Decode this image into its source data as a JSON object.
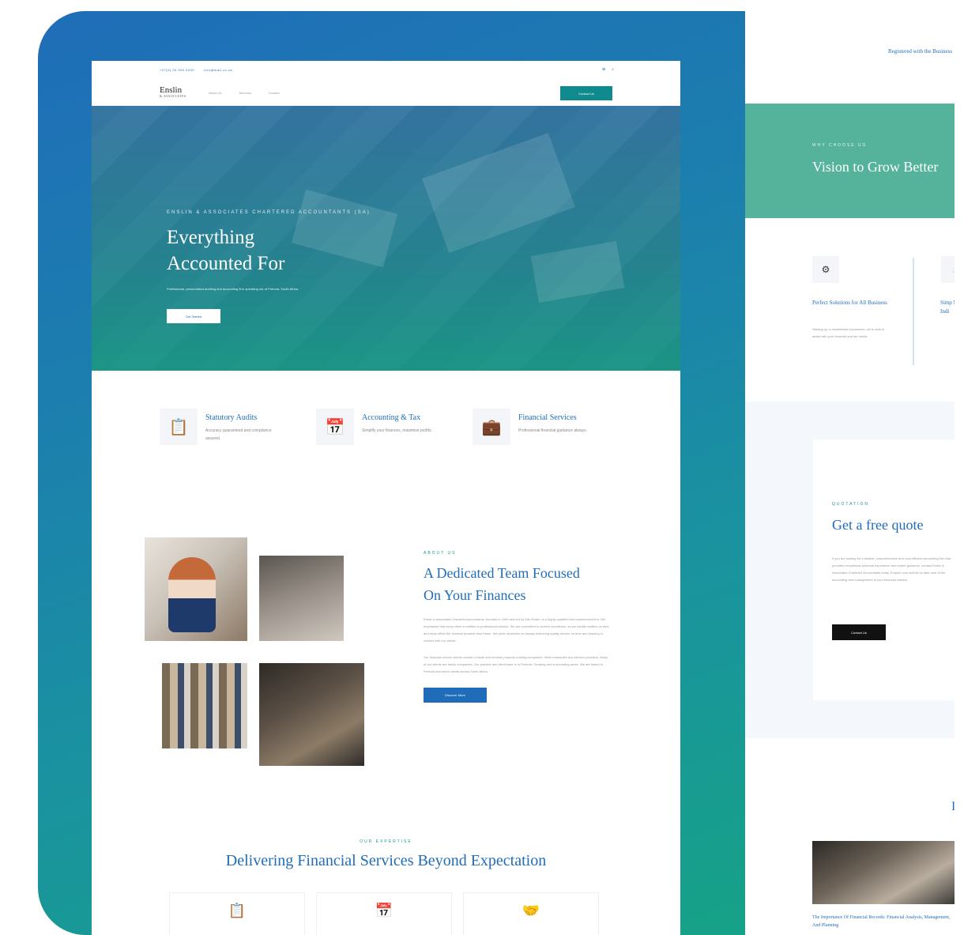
{
  "main_page": {
    "topbar": {
      "util_links": [
        "+27(0) 00 000 0000",
        "info@mail.co.za"
      ],
      "util_icons": [
        "globe-icon",
        "search-icon"
      ],
      "logo_name": "Enslin",
      "logo_sub": "& ASSOCIATES",
      "nav_items": [
        "About Us",
        "Services",
        "Contact"
      ],
      "contact_button": "Contact Us"
    },
    "hero": {
      "eyebrow": "ENSLIN & ASSOCIATES CHARTERED ACCOUNTANTS (SA)",
      "title_line1": "Everything",
      "title_line2": "Accounted For",
      "subtitle": "Professional, personalised auditing and accounting firm operating out of Pretoria, South Africa.",
      "cta": "Get Started"
    },
    "features": [
      {
        "icon": "clipboard-icon",
        "title": "Statutory Audits",
        "desc": "Accuracy guaranteed and compliance assured."
      },
      {
        "icon": "calendar-icon",
        "title": "Accounting & Tax",
        "desc": "Simplify your finances, maximise profits."
      },
      {
        "icon": "briefcase-icon",
        "title": "Financial Services",
        "desc": "Professional financial guidance always."
      }
    ],
    "about": {
      "eyebrow": "ABOUT US",
      "title_line1": "A Dedicated Team Focused",
      "title_line2": "On Your Finances",
      "para1": "Enslin & Associates Chartered Accountants, founded in 1999 and led by Dirk Enslin, is a highly qualified and experienced firm. We emphasise that every client is entitled to professional service. We are committed to service excellence, so we handle matters on time and reply within the shortest possible time frame. We pride ourselves on always delivering quality service on time and keeping in contact with our clients.",
      "para2": "Our financial service clients consist of small and medium property holding companies, retail companies and service providers. Many of our clients are family companies. Our practice and client base is in Pretoria, Gauteng and surrounding areas. We are based in Pretoria and serve clients across South Africa.",
      "cta": "Discover More"
    },
    "expertise": {
      "eyebrow": "OUR EXPERTISE",
      "title": "Delivering Financial Services Beyond Expectation",
      "card_icons": [
        "clipboard-icon",
        "calendar-icon",
        "handshake-icon"
      ]
    }
  },
  "side_page": {
    "registered": "Registered with the Business",
    "why_eyebrow": "WHY CHOOSE US",
    "why_title": "Vision to Grow Better",
    "feature_title": "Perfect Solutions for All Business",
    "feature_desc": "Starting up or established businesses, we're able to assist with your financial and tax needs.",
    "feature2_title": "Simp Mat Indi",
    "quote": {
      "eyebrow": "QUOTATION",
      "title": "Get a free quote",
      "desc": "If you are looking for a reliable, comprehensive and cost-efficient accounting firm that provides exceptional personal experience and expert guidance, contact Enslin & Associates Chartered Accountants today. Enquire now and let us take care of the accounting and management of your financial matters.",
      "cta": "Contact Us"
    },
    "blog_title": "The Importance Of Financial Records: Financial Analysis, Management, And Planning"
  }
}
